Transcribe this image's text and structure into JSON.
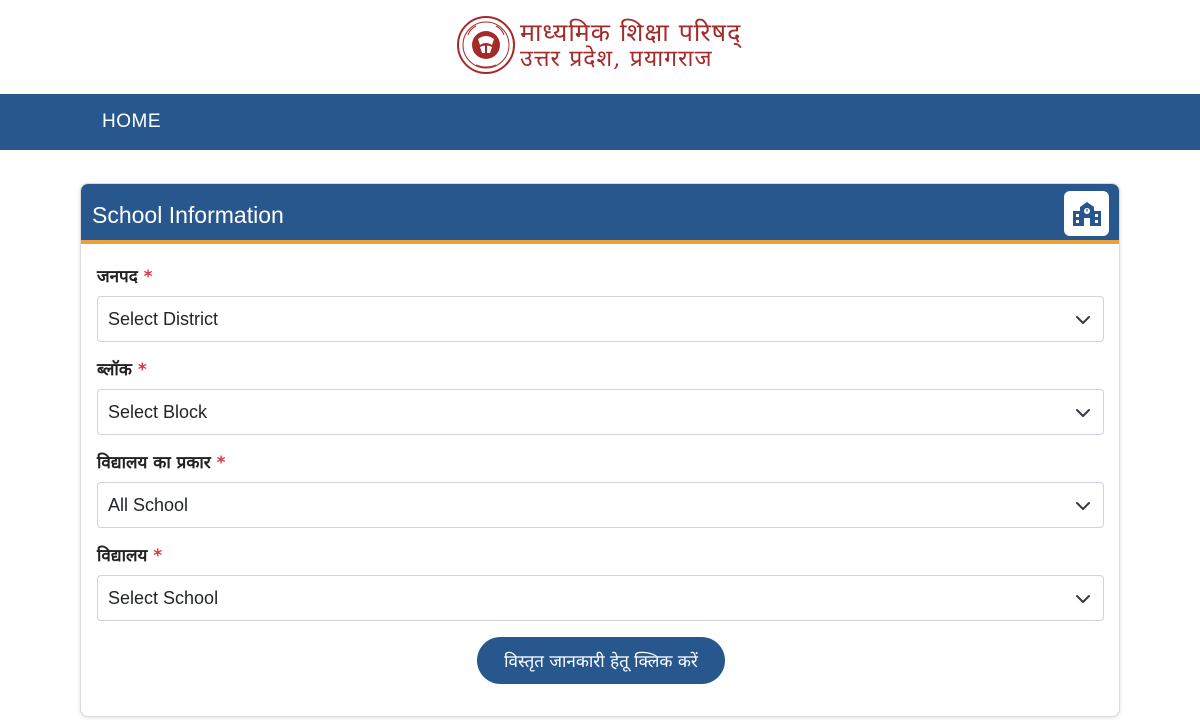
{
  "header": {
    "logo_line1": "माध्यमिक शिक्षा परिषद्",
    "logo_line2": "उत्तर प्रदेश, प्रयागराज",
    "seal_icon": "up-govt-seal-icon",
    "brand_color": "#a52a2a"
  },
  "nav": {
    "home_label": "HOME",
    "bg_color": "#28578e"
  },
  "card": {
    "title": "School Information",
    "icon": "school-building-icon",
    "accent_color": "#e9a23b"
  },
  "form": {
    "fields": [
      {
        "label": "जनपद",
        "required_mark": "*",
        "value": "Select District"
      },
      {
        "label": "ब्लॉक",
        "required_mark": "*",
        "value": "Select Block"
      },
      {
        "label": "विद्यालय का प्रकार",
        "required_mark": "*",
        "value": "All School"
      },
      {
        "label": "विद्यालय",
        "required_mark": "*",
        "value": "Select School"
      }
    ],
    "submit_label": "विस्तृत जानकारी हेतू क्लिक करें"
  }
}
